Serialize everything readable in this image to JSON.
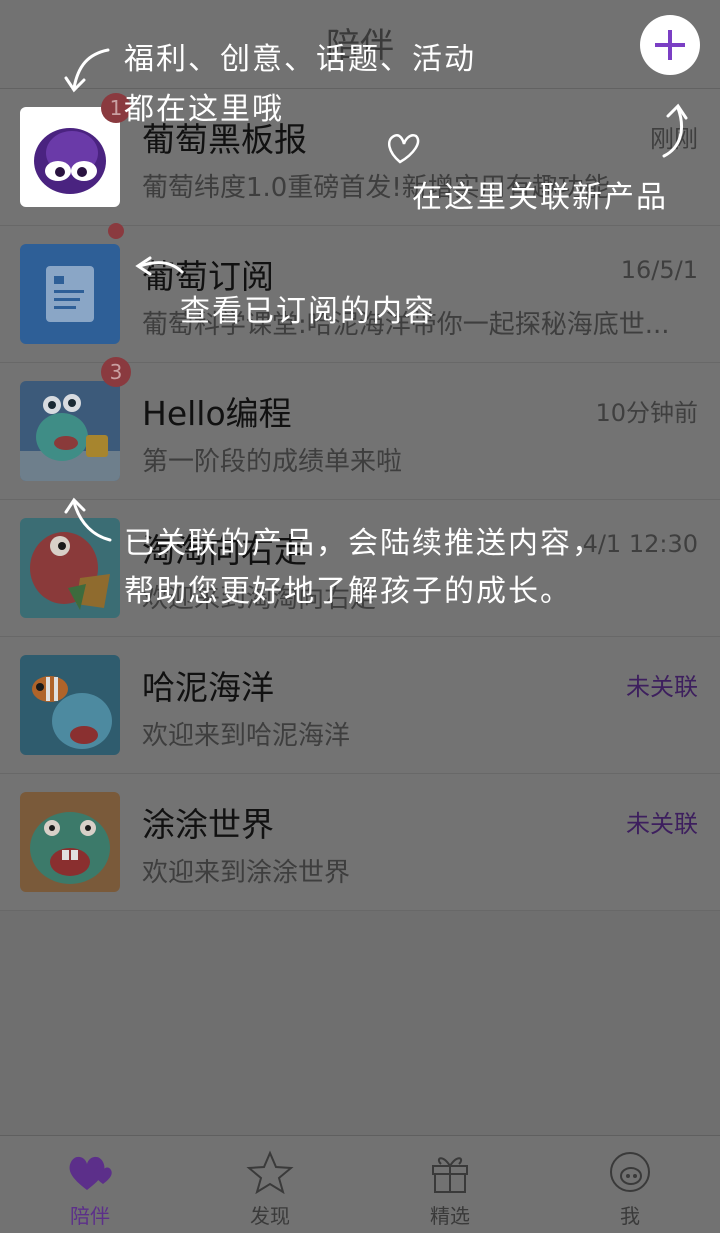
{
  "header": {
    "title": "陪伴",
    "add_icon": "plus-icon"
  },
  "list": [
    {
      "icon": "putao-blackboard-icon",
      "badge": "1",
      "title": "葡萄黑板报",
      "subtitle": "葡萄纬度1.0重磅首发!新增实用有趣功能",
      "time": "刚刚"
    },
    {
      "icon": "subscription-document-icon",
      "badge": "",
      "title": "葡萄订阅",
      "subtitle": "葡萄科学课堂:哈泥海洋带你一起探秘海底世...",
      "time": "16/5/1"
    },
    {
      "icon": "hello-coding-app-icon",
      "badge": "3",
      "title": "Hello编程",
      "subtitle": "第一阶段的成绩单来啦",
      "time": "10分钟前"
    },
    {
      "icon": "taotao-puzzle-app-icon",
      "badge": "",
      "title": "淘淘向右走",
      "subtitle": "欢迎来到淘淘向右走",
      "time": "4/1 12:30"
    },
    {
      "icon": "hani-ocean-app-icon",
      "badge": "",
      "title": "哈泥海洋",
      "subtitle": "欢迎来到哈泥海洋",
      "status": "未关联"
    },
    {
      "icon": "tutu-world-app-icon",
      "badge": "",
      "title": "涂涂世界",
      "subtitle": "欢迎来到涂涂世界",
      "status": "未关联"
    }
  ],
  "tabs": [
    {
      "label": "陪伴",
      "icon": "hearts-icon",
      "active": true
    },
    {
      "label": "发现",
      "icon": "star-icon",
      "active": false
    },
    {
      "label": "精选",
      "icon": "gift-icon",
      "active": false
    },
    {
      "label": "我",
      "icon": "profile-face-icon",
      "active": false
    }
  ],
  "annotations": {
    "welfare_line1": "福利、创意、话题、活动",
    "welfare_line2": "都在这里哦",
    "add_product": "在这里关联新产品",
    "view_subscribed": "查看已订阅的内容",
    "linked_line1": "已关联的产品，会陆续推送内容，",
    "linked_line2": "帮助您更好地了解孩子的成长。"
  },
  "colors": {
    "accent": "#7b3fc4",
    "overlay": "#6f6f6f",
    "badge": "#8a3a3f",
    "unlinked": "#3d1f5e"
  }
}
